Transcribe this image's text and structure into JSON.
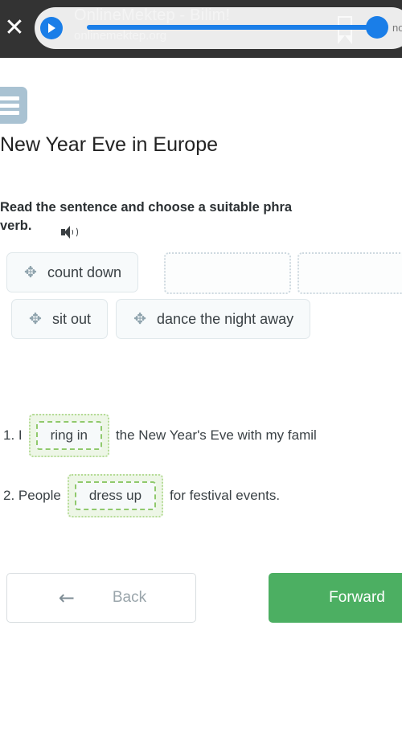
{
  "browser_bar": {
    "close_icon": "close-icon",
    "play_icon": "play-icon",
    "title": "OnlineMektep - Bilim!",
    "subtitle": "onlinemektep.org",
    "bookmark_icon": "bookmark-icon",
    "seek_right_label": "no"
  },
  "page": {
    "menu_icon": "hamburger-menu-icon",
    "title": "New Year Eve in Europe",
    "task_line1": "Read the sentence and choose a suitable phra",
    "task_line2": "verb.",
    "speaker_icon": "speaker-icon"
  },
  "word_bank": {
    "move_icon": "✥",
    "chips": [
      {
        "label": "count down"
      },
      {
        "label": "sit out"
      },
      {
        "label": "dance the night away"
      }
    ],
    "empty_slots": [
      {
        "label": ""
      },
      {
        "label": ""
      }
    ]
  },
  "questions": [
    {
      "number": "1. I",
      "answer": "ring in",
      "tail": "the New Year's Eve with my famil"
    },
    {
      "number": "2. People",
      "answer": "dress up",
      "tail": "for festival events."
    }
  ],
  "footer": {
    "back_label": "Back",
    "back_icon": "←",
    "forward_label": "Forward"
  },
  "colors": {
    "forward_green": "#4caf62",
    "accent_blue": "#1a7ee8",
    "menu_blue_gray": "#a9c2d2",
    "answer_zone_green_bg": "#edf6e6",
    "answer_zone_green_border": "#90c96c"
  }
}
